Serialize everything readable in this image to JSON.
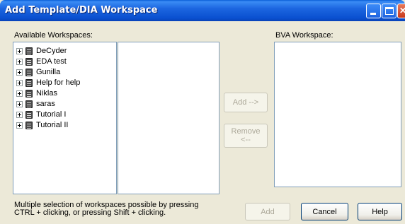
{
  "window": {
    "title": "Add Template/DIA Workspace"
  },
  "available": {
    "label": "Available Workspaces:",
    "items": [
      "DeCyder",
      "EDA test",
      "Gunilla",
      "Help for help",
      "Niklas",
      "saras",
      "Tutorial I",
      "Tutorial II"
    ]
  },
  "bva": {
    "label": "BVA Workspace:"
  },
  "buttons": {
    "add_arrow": "Add -->",
    "remove_line1": "Remove",
    "remove_line2": "<--",
    "add": "Add",
    "cancel": "Cancel",
    "help": "Help"
  },
  "hint": {
    "line1": "Multiple selection of workspaces possible by pressing",
    "line2": "CTRL + clicking, or pressing Shift + clicking."
  }
}
